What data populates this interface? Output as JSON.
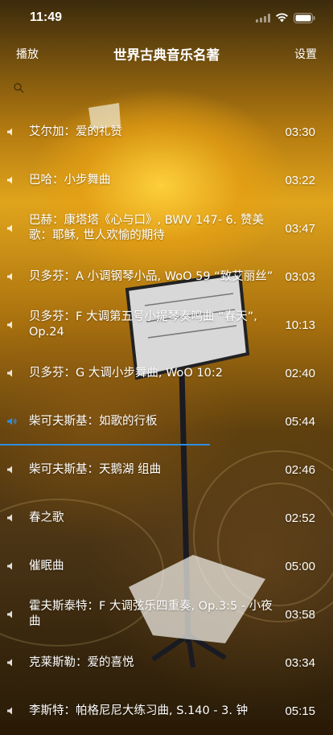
{
  "status": {
    "time": "11:49"
  },
  "nav": {
    "left": "播放",
    "title": "世界古典音乐名著",
    "right": "设置"
  },
  "colors": {
    "accent": "#2d8ee0",
    "text": "#ffffff"
  },
  "tracks": [
    {
      "title": "艾尔加：爱的礼赞",
      "duration": "03:30",
      "playing": false
    },
    {
      "title": "巴哈：小步舞曲",
      "duration": "03:22",
      "playing": false
    },
    {
      "title": "巴赫：康塔塔《心与口》, BWV 147- 6. 赞美歌：耶稣, 世人欢愉的期待",
      "duration": "03:47",
      "playing": false
    },
    {
      "title": "贝多芬：A 小调钢琴小品, WoO 59 “致艾丽丝”",
      "duration": "03:03",
      "playing": false
    },
    {
      "title": "贝多芬：F 大调第五号小提琴奏鸣曲 “春天”, Op.24",
      "duration": "10:13",
      "playing": false
    },
    {
      "title": "贝多芬：G 大调小步舞曲, WoO 10:2",
      "duration": "02:40",
      "playing": false
    },
    {
      "title": "柴可夫斯基：如歌的行板",
      "duration": "05:44",
      "playing": true,
      "progress": 0.63
    },
    {
      "title": "柴可夫斯基：天鹅湖 组曲",
      "duration": "02:46",
      "playing": false
    },
    {
      "title": "春之歌",
      "duration": "02:52",
      "playing": false
    },
    {
      "title": "催眠曲",
      "duration": "05:00",
      "playing": false
    },
    {
      "title": "霍夫斯泰特：F 大调弦乐四重奏, Op.3:5 - 小夜曲",
      "duration": "03:58",
      "playing": false
    },
    {
      "title": "克莱斯勒：爱的喜悦",
      "duration": "03:34",
      "playing": false
    },
    {
      "title": "李斯特：帕格尼尼大练习曲, S.140 - 3. 钟",
      "duration": "05:15",
      "playing": false
    }
  ]
}
